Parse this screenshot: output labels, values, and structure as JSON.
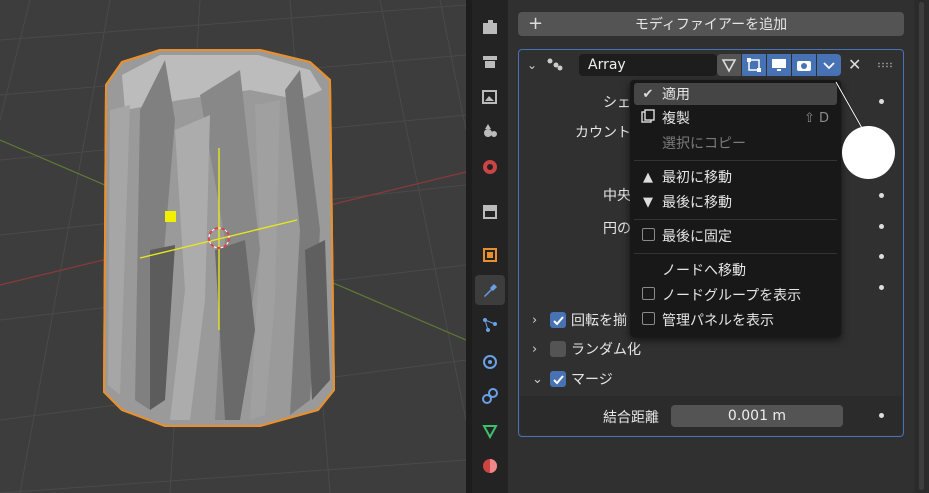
{
  "properties": {
    "add_modifier_label": "モディファイアーを追加",
    "modifier": {
      "name": "Array",
      "rows": {
        "shape_label": "シェ",
        "count_label": "カウント",
        "center_label": "中央",
        "circle_label": "円の"
      },
      "subpanels": [
        {
          "label": "回転を揃",
          "checked": true,
          "expanded": false
        },
        {
          "label": "ランダム化",
          "checked": false,
          "expanded": false
        },
        {
          "label": "マージ",
          "checked": true,
          "expanded": true
        }
      ],
      "merge_distance_label": "結合距離",
      "merge_distance_value": "0.001 m"
    }
  },
  "context_menu": {
    "apply": "適用",
    "duplicate": "複製",
    "duplicate_shortcut": "⇧ D",
    "copy_to_selected": "選択にコピー",
    "move_first": "最初に移動",
    "move_last": "最後に移動",
    "pin_last": "最後に固定",
    "move_to_nodes": "ノードへ移動",
    "show_node_group": "ノードグループを表示",
    "show_manager_panel": "管理パネルを表示"
  },
  "icons": {
    "tabs": [
      "tool-icon",
      "render-icon",
      "output-icon",
      "view-layer-icon",
      "scene-icon",
      "world-icon",
      "collection-icon",
      "object-icon",
      "modifier-icon",
      "particles-icon",
      "physics-icon",
      "constraints-icon",
      "data-icon",
      "material-icon"
    ]
  },
  "colors": {
    "accent": "#4772b3",
    "object_outline": "#e8902e",
    "background": "#303030",
    "viewport": "#3d3d3d"
  }
}
